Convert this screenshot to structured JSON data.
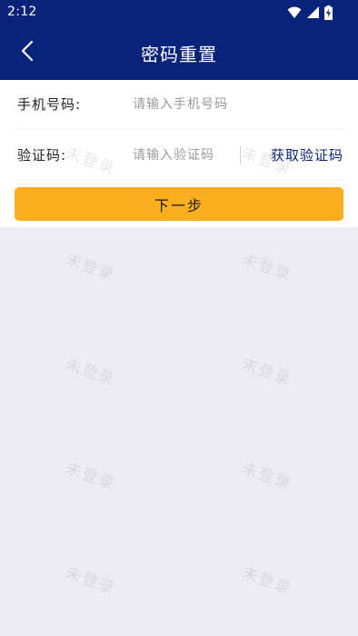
{
  "status_bar": {
    "time": "2:12",
    "icons": [
      "wifi-icon",
      "signal-icon",
      "battery-charging-icon"
    ]
  },
  "header": {
    "title": "密码重置",
    "back_icon": "chevron-left-icon"
  },
  "form": {
    "phone": {
      "label": "手机号码:",
      "value": "",
      "placeholder": "请输入手机号码"
    },
    "code": {
      "label": "验证码:",
      "value": "",
      "placeholder": "请输入验证码",
      "get_code_label": "获取验证码"
    },
    "next_label": "下一步"
  },
  "watermark_text": "未登录",
  "colors": {
    "header_bg": "#0A237A",
    "accent_button": "#FBAE1F",
    "link": "#0A237A",
    "page_bg": "#ECEDF1"
  }
}
